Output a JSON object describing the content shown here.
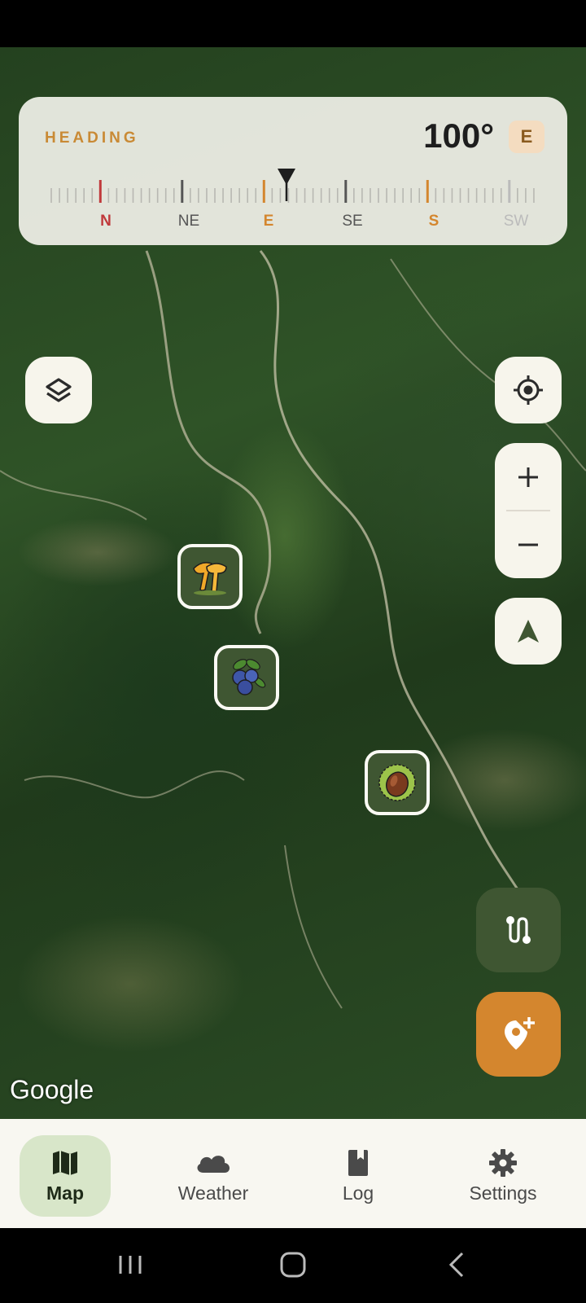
{
  "compass": {
    "label": "HEADING",
    "value": "100°",
    "direction": "E",
    "scale": [
      "N",
      "NE",
      "E",
      "SE",
      "S",
      "SW"
    ]
  },
  "map": {
    "attribution": "Google",
    "markers": [
      "chanterelle-mushroom",
      "blueberries",
      "chestnut"
    ]
  },
  "nav": {
    "items": [
      {
        "label": "Map",
        "icon": "map-icon"
      },
      {
        "label": "Weather",
        "icon": "cloud-icon"
      },
      {
        "label": "Log",
        "icon": "book-icon"
      },
      {
        "label": "Settings",
        "icon": "gear-icon"
      }
    ],
    "active": "Map"
  },
  "colors": {
    "accent": "#d4862e",
    "primary": "#3f5632",
    "nav_active_bg": "#d8e6c9"
  }
}
